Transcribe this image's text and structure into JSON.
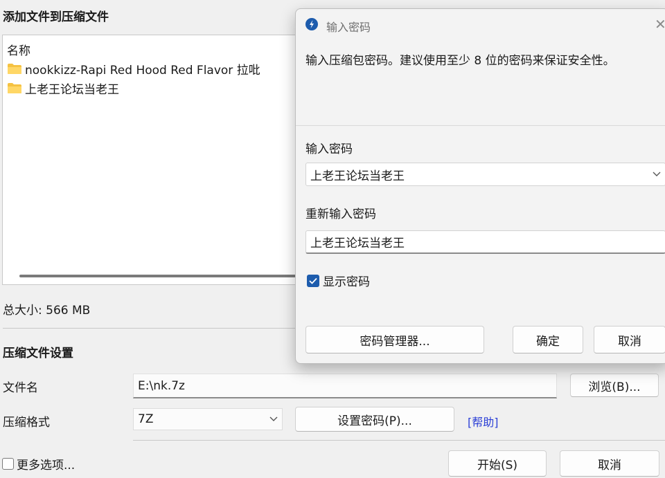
{
  "main": {
    "title": "添加文件到压缩文件",
    "file_list": {
      "column_header": "名称",
      "items": [
        {
          "icon": "folder-icon",
          "name": "nookkizz-Rapi Red Hood Red Flavor 拉吡"
        },
        {
          "icon": "folder-icon",
          "name": "上老王论坛当老王"
        }
      ]
    },
    "total_size": "总大小: 566 MB",
    "settings_title": "压缩文件设置",
    "filename_label": "文件名",
    "filename_value": "E:\\nk.7z",
    "browse_label": "浏览(B)...",
    "format_label": "压缩格式",
    "format_value": "7Z",
    "set_password_label": "设置密码(P)...",
    "help_label": "[帮助]",
    "more_options_label": "更多选项...",
    "more_options_checked": false,
    "start_label": "开始(S)",
    "cancel_label": "取消"
  },
  "dialog": {
    "title": "输入密码",
    "description": "输入压缩包密码。建议使用至少 8 位的密码来保证安全性。",
    "password_label": "输入密码",
    "password_value": "上老王论坛当老王",
    "reenter_label": "重新输入密码",
    "reenter_value": "上老王论坛当老王",
    "show_password_label": "显示密码",
    "show_password_checked": true,
    "password_manager_label": "密码管理器...",
    "ok_label": "确定",
    "cancel_label": "取消"
  },
  "colors": {
    "accent": "#1d5cad",
    "link": "#2b3fd6",
    "folder": "#f5c242"
  }
}
